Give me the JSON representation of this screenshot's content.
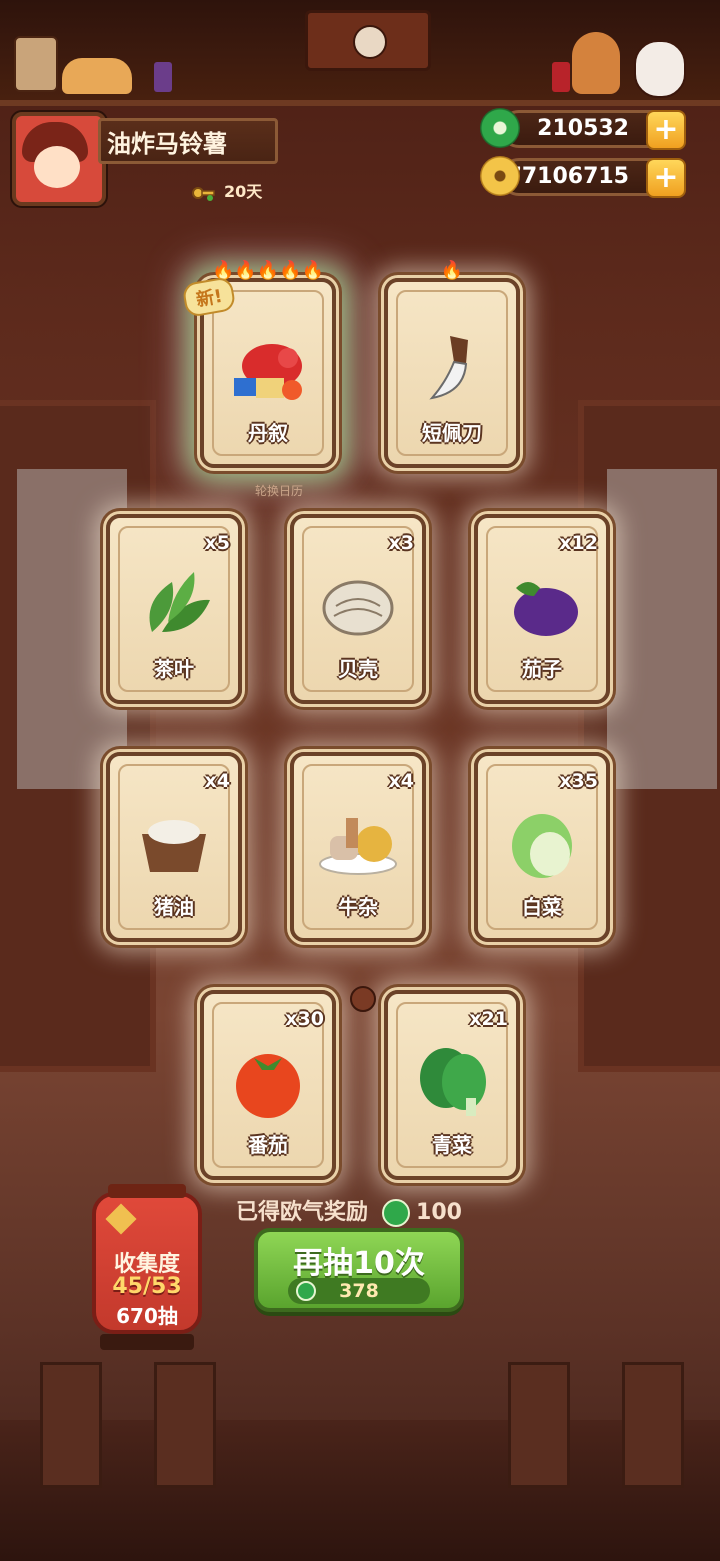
{
  "header": {
    "player_name": "油炸马铃薯",
    "days": "20天",
    "jade_amount": "210532",
    "coin_amount": "77106715",
    "plus_label": "+"
  },
  "featured_cards": [
    {
      "label": "丹叙",
      "flames": "🔥🔥🔥🔥🔥",
      "badge": "新!",
      "icon": "red-creature-icon",
      "rarity": "rainbow"
    },
    {
      "label": "短佩刀",
      "flames": "🔥",
      "icon": "knife-icon"
    }
  ],
  "caption_under_featured": "轮换日历",
  "cards": [
    {
      "label": "茶叶",
      "qty": "x5",
      "icon": "tea-leaf-icon"
    },
    {
      "label": "贝壳",
      "qty": "x3",
      "icon": "clam-shell-icon"
    },
    {
      "label": "茄子",
      "qty": "x12",
      "icon": "eggplant-icon"
    },
    {
      "label": "猪油",
      "qty": "x4",
      "icon": "lard-bowl-icon"
    },
    {
      "label": "牛杂",
      "qty": "x4",
      "icon": "beef-offal-icon"
    },
    {
      "label": "白菜",
      "qty": "x35",
      "icon": "napa-cabbage-icon"
    },
    {
      "label": "番茄",
      "qty": "x30",
      "icon": "tomato-icon"
    },
    {
      "label": "青菜",
      "qty": "x21",
      "icon": "bok-choy-icon"
    }
  ],
  "reward": {
    "text": "已得欧气奖励",
    "amount": "100"
  },
  "draw_button": {
    "label": "再抽10次",
    "cost": "378"
  },
  "collection": {
    "title": "收集度",
    "progress": "45/53",
    "draws": "670抽"
  },
  "colors": {
    "jade": "#2fa84a",
    "button_green": "#6cb83a",
    "lantern_red": "#d44133",
    "card_bg": "#f2dfbb"
  }
}
